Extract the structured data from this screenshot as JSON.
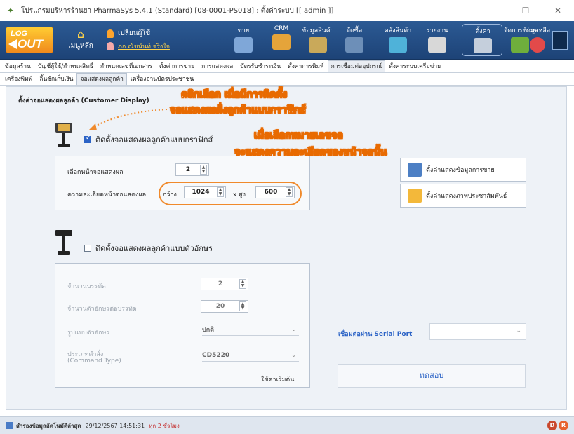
{
  "window": {
    "title": "โปรแกรมบริหารร้านยา PharmaSys 5.4.1 (Standard) [08-0001-PS018] : ตั้งค่าระบบ  [[ admin ]]"
  },
  "ribbon": {
    "logout_top": "LOG",
    "logout_bottom": "OUT",
    "home_label": "เมนูหลัก",
    "change_user": "เปลี่ยนผู้ใช้",
    "user_name": "ภก.ณัชนันท์ จริงใจ",
    "menu": [
      "ขาย",
      "CRM",
      "ข้อมูลสินค้า",
      "จัดซื้อ",
      "คลังสินค้า",
      "รายงาน",
      "ตั้งค่า",
      "จัดการข้อมูล",
      "ช่วยเหลือ"
    ]
  },
  "tabs_row1": [
    "ข้อมูลร้าน",
    "บัญชีผู้ใช้/กำหนดสิทธิ์",
    "กำหนดเลขที่เอกสาร",
    "ตั้งค่าการขาย",
    "การแสดงผล",
    "บัตรรับชำระเงิน",
    "ตั้งค่าการพิมพ์",
    "การเชื่อมต่ออุปกรณ์",
    "ตั้งค่าระบบเครือข่าย"
  ],
  "tabs_row2": [
    "เครื่องพิมพ์",
    "ลิ้นชักเก็บเงิน",
    "จอแสดงผลลูกค้า",
    "เครื่องอ่านบัตรประชาชน"
  ],
  "section_title": "ตั้งค่าจอแสดงผลลูกค้า (Customer Display)",
  "annotations": {
    "a1_line1": "คลิกเลือก เมื่อมีการติดตั้ง",
    "a1_line2": "จอแสดงผลฝั่งลูกค้าแบบกราฟิกส์",
    "a2_line1": "เมื่อเลือกหมายเลขจอ",
    "a2_line2": "จะแสดงความละเอียดของหน้าจอนั้น"
  },
  "graphic_display": {
    "checkbox_label": "ติดตั้งจอแสดงผลลูกค้าแบบกราฟิกส์",
    "checked": true,
    "select_screen_label": "เลือกหน้าจอแสดงผล",
    "screen_value": "2",
    "resolution_label": "ความละเอียดหน้าจอแสดงผล",
    "width_label": "กว้าง",
    "width_value": "1024",
    "height_label": "x สูง",
    "height_value": "600",
    "btn_sales": "ตั้งค่าแสดงข้อมูลการขาย",
    "btn_promo": "ตั้งค่าแสดงภาพประชาสัมพันธ์"
  },
  "text_display": {
    "checkbox_label": "ติดตั้งจอแสดงผลลูกค้าแบบตัวอักษร",
    "checked": false,
    "lines_label": "จำนวนบรรทัด",
    "lines_value": "2",
    "chars_label": "จำนวนตัวอักษรต่อบรรทัด",
    "chars_value": "20",
    "font_label": "รูปแบบตัวอักษร",
    "font_value": "ปกติ",
    "cmd_label_1": "ประเภทคำสั่ง",
    "cmd_label_2": "(Command Type)",
    "cmd_value": "CD5220",
    "default_link": "ใช้ค่าเริ่มต้น",
    "serial_label": "เชื่อมต่อผ่าน Serial Port",
    "serial_value": "",
    "test_button": "ทดสอบ"
  },
  "status": {
    "label": "สำรองข้อมูลอัตโนมัติล่าสุด",
    "datetime": "29/12/2567 14:51:31",
    "ago": "ทุก 2 ชั่วโมง",
    "badge1": "D",
    "badge2": "R"
  },
  "colors": {
    "ribbon": "#1d4377",
    "accent": "#f08a2c",
    "link_blue": "#2b63c6"
  }
}
